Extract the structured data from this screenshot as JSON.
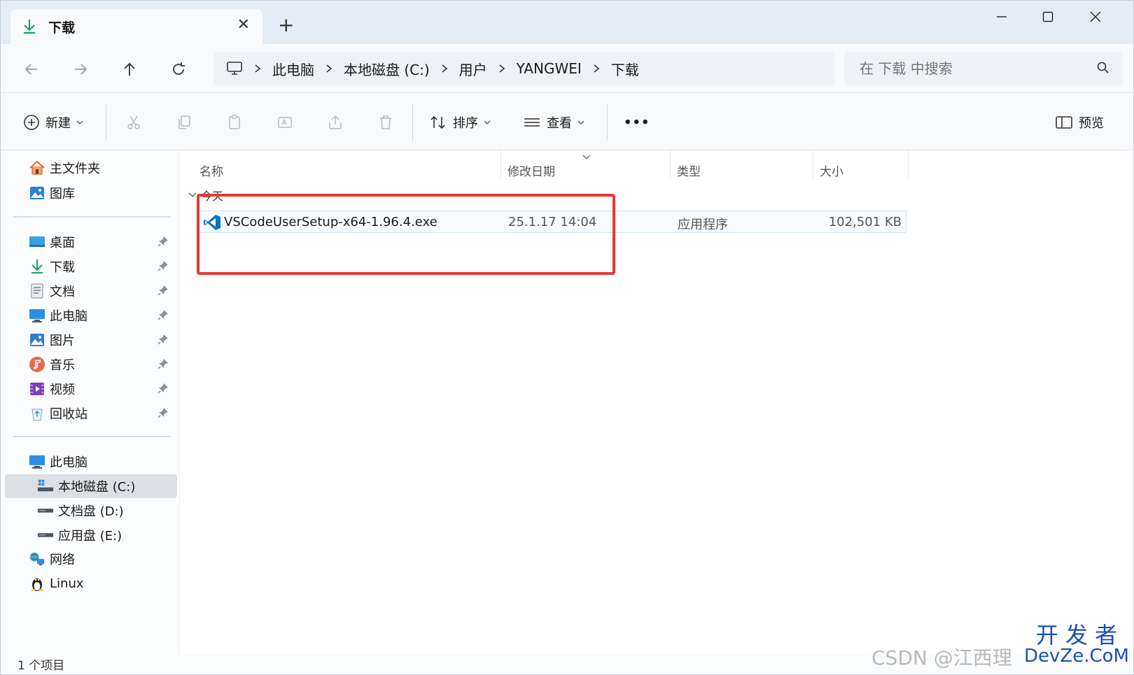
{
  "tab": {
    "title": "下载",
    "close": "✕",
    "new_tab": "+"
  },
  "window_controls": {
    "minimize": "—",
    "maximize": "☐",
    "close": "✕"
  },
  "nav": {
    "back": "←",
    "forward": "→",
    "up": "↑",
    "refresh": "⟳"
  },
  "breadcrumb": [
    "此电脑",
    "本地磁盘 (C:)",
    "用户",
    "YANGWEI",
    "下载"
  ],
  "search": {
    "placeholder": "在 下载 中搜索"
  },
  "toolbar": {
    "new_label": "新建",
    "sort_label": "排序",
    "view_label": "查看",
    "more_label": "•••",
    "preview_label": "预览"
  },
  "sidebar": {
    "quick": [
      {
        "label": "主文件夹",
        "icon": "home-icon"
      },
      {
        "label": "图库",
        "icon": "gallery-icon"
      }
    ],
    "pinned": [
      {
        "label": "桌面",
        "icon": "desktop-icon"
      },
      {
        "label": "下载",
        "icon": "download-icon"
      },
      {
        "label": "文档",
        "icon": "document-icon"
      },
      {
        "label": "此电脑",
        "icon": "computer-icon"
      },
      {
        "label": "图片",
        "icon": "picture-icon"
      },
      {
        "label": "音乐",
        "icon": "music-icon"
      },
      {
        "label": "视频",
        "icon": "video-icon"
      },
      {
        "label": "回收站",
        "icon": "recycle-bin-icon"
      }
    ],
    "tree": [
      {
        "label": "此电脑",
        "icon": "computer-icon"
      },
      {
        "label": "本地磁盘 (C:)",
        "icon": "drive-c-icon"
      },
      {
        "label": "文档盘 (D:)",
        "icon": "drive-icon"
      },
      {
        "label": "应用盘 (E:)",
        "icon": "drive-icon"
      },
      {
        "label": "网络",
        "icon": "network-icon"
      },
      {
        "label": "Linux",
        "icon": "linux-icon"
      }
    ]
  },
  "columns": {
    "name": "名称",
    "modified": "修改日期",
    "type": "类型",
    "size": "大小"
  },
  "group": {
    "label": "今天"
  },
  "files": [
    {
      "name": "VSCodeUserSetup-x64-1.96.4.exe",
      "modified": "25.1.17 14:04",
      "type": "应用程序",
      "size": "102,501 KB",
      "icon": "vscode-icon"
    }
  ],
  "status": {
    "count": "1 个项目"
  },
  "watermarks": {
    "csdn": "CSDN @江西理",
    "devze_top": "开 发 者",
    "devze_bottom": "DevZe.CoM"
  },
  "colors": {
    "accent": "#0067c0",
    "highlight": "#e53935",
    "selected": "#dcdfe3"
  }
}
